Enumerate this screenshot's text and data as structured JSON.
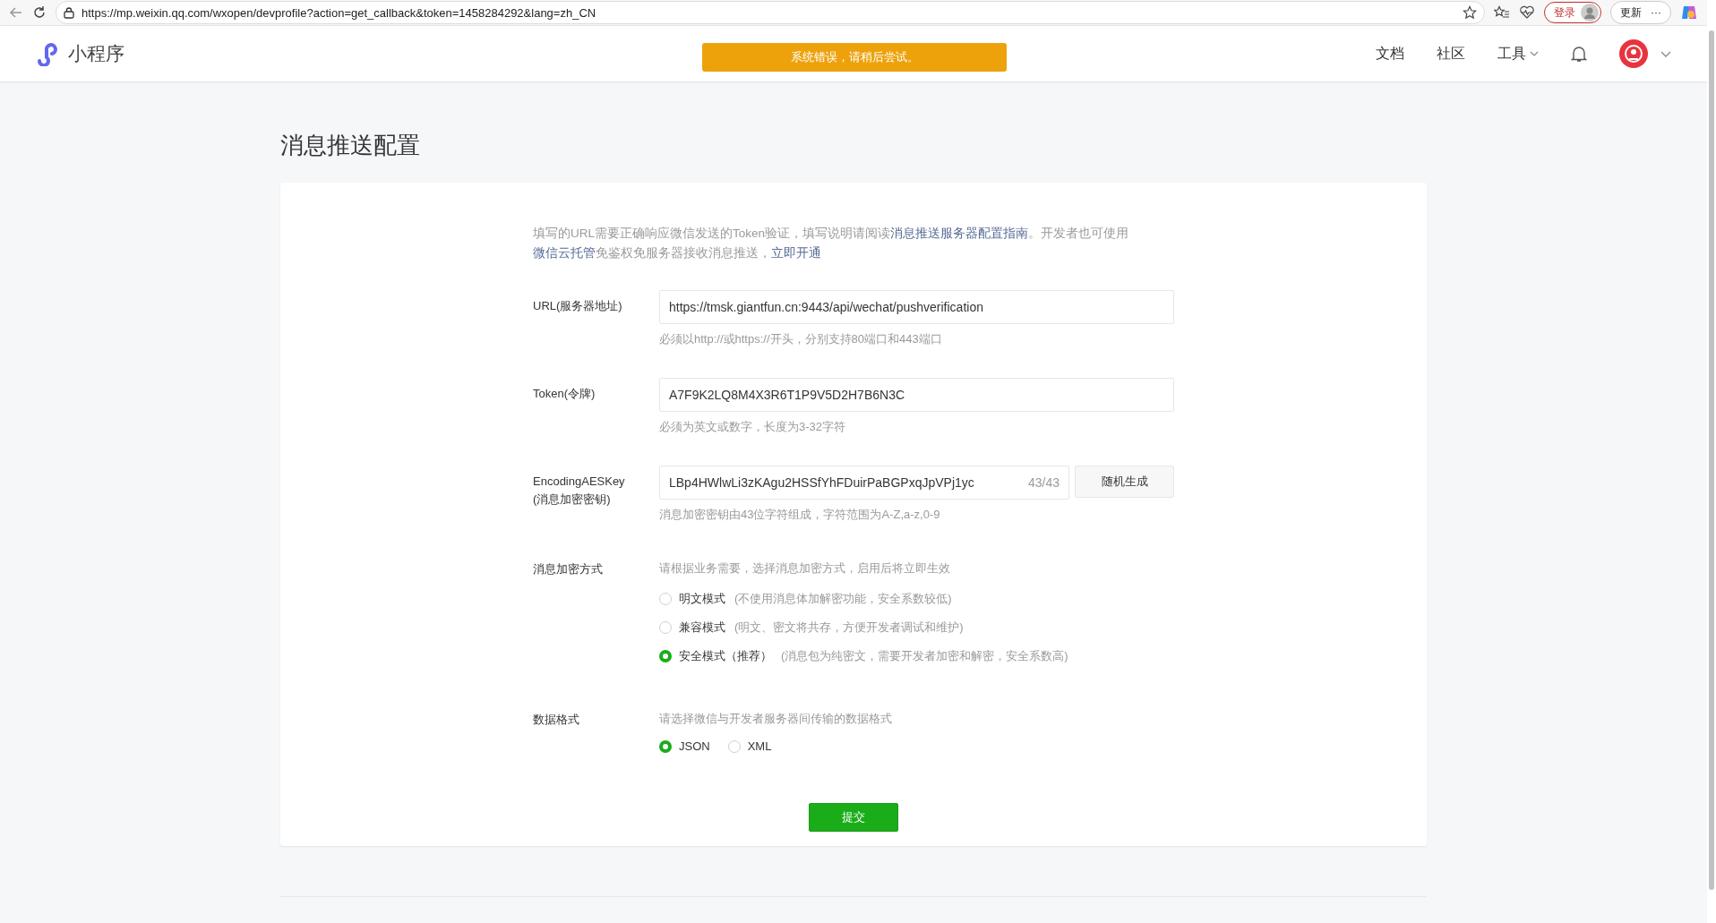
{
  "browser": {
    "url": "https://mp.weixin.qq.com/wxopen/devprofile?action=get_callback&token=1458284292&lang=zh_CN",
    "login_button": "登录",
    "update_button": "更新",
    "more_button": "···"
  },
  "header": {
    "logo_text": "小程序",
    "alert": "系统错误，请稍后尝试。",
    "nav": [
      {
        "label": "文档",
        "dropdown": false
      },
      {
        "label": "社区",
        "dropdown": false
      },
      {
        "label": "工具",
        "dropdown": true
      }
    ]
  },
  "page_title": "消息推送配置",
  "description": [
    {
      "kind": "text",
      "text": "填写的URL需要正确响应微信发送的Token验证，填写说明请阅读"
    },
    {
      "kind": "link",
      "text": "消息推送服务器配置指南"
    },
    {
      "kind": "text",
      "text": "。开发者也可使用"
    },
    {
      "kind": "link",
      "text": "微信云托管"
    },
    {
      "kind": "text",
      "text": "免鉴权免服务器接收消息推送，"
    },
    {
      "kind": "link",
      "text": "立即开通"
    }
  ],
  "fields": [
    {
      "label": "URL(服务器地址)",
      "value": "https://tmsk.giantfun.cn:9443/api/wechat/pushverification",
      "hint": "必须以http://或https://开头，分别支持80端口和443端口"
    },
    {
      "label": "Token(令牌)",
      "value": "A7F9K2LQ8M4X3R6T1P9V5D2H7B6N3C",
      "hint": "必须为英文或数字，长度为3-32字符"
    },
    {
      "label": "EncodingAESKey",
      "sublabel": "(消息加密密钥)",
      "value": "LBp4HWlwLi3zKAgu2HSSfYhFDuirPaBGPxqJpVPj1yc",
      "counter": "43/43",
      "button": "随机生成",
      "hint": "消息加密密钥由43位字符组成，字符范围为A-Z,a-z,0-9"
    }
  ],
  "encryption": {
    "label": "消息加密方式",
    "hint": "请根据业务需要，选择消息加密方式，启用后将立即生效",
    "options": [
      {
        "label": "明文模式",
        "note": "(不使用消息体加解密功能，安全系数较低)",
        "selected": false
      },
      {
        "label": "兼容模式",
        "note": "(明文、密文将共存，方便开发者调试和维护)",
        "selected": false
      },
      {
        "label": "安全模式（推荐）",
        "note": "(消息包为纯密文，需要开发者加密和解密，安全系数高)",
        "selected": true
      }
    ]
  },
  "data_format": {
    "label": "数据格式",
    "hint": "请选择微信与开发者服务器间传输的数据格式",
    "options": [
      {
        "label": "JSON",
        "selected": true
      },
      {
        "label": "XML",
        "selected": false
      }
    ]
  },
  "submit_button": "提交"
}
